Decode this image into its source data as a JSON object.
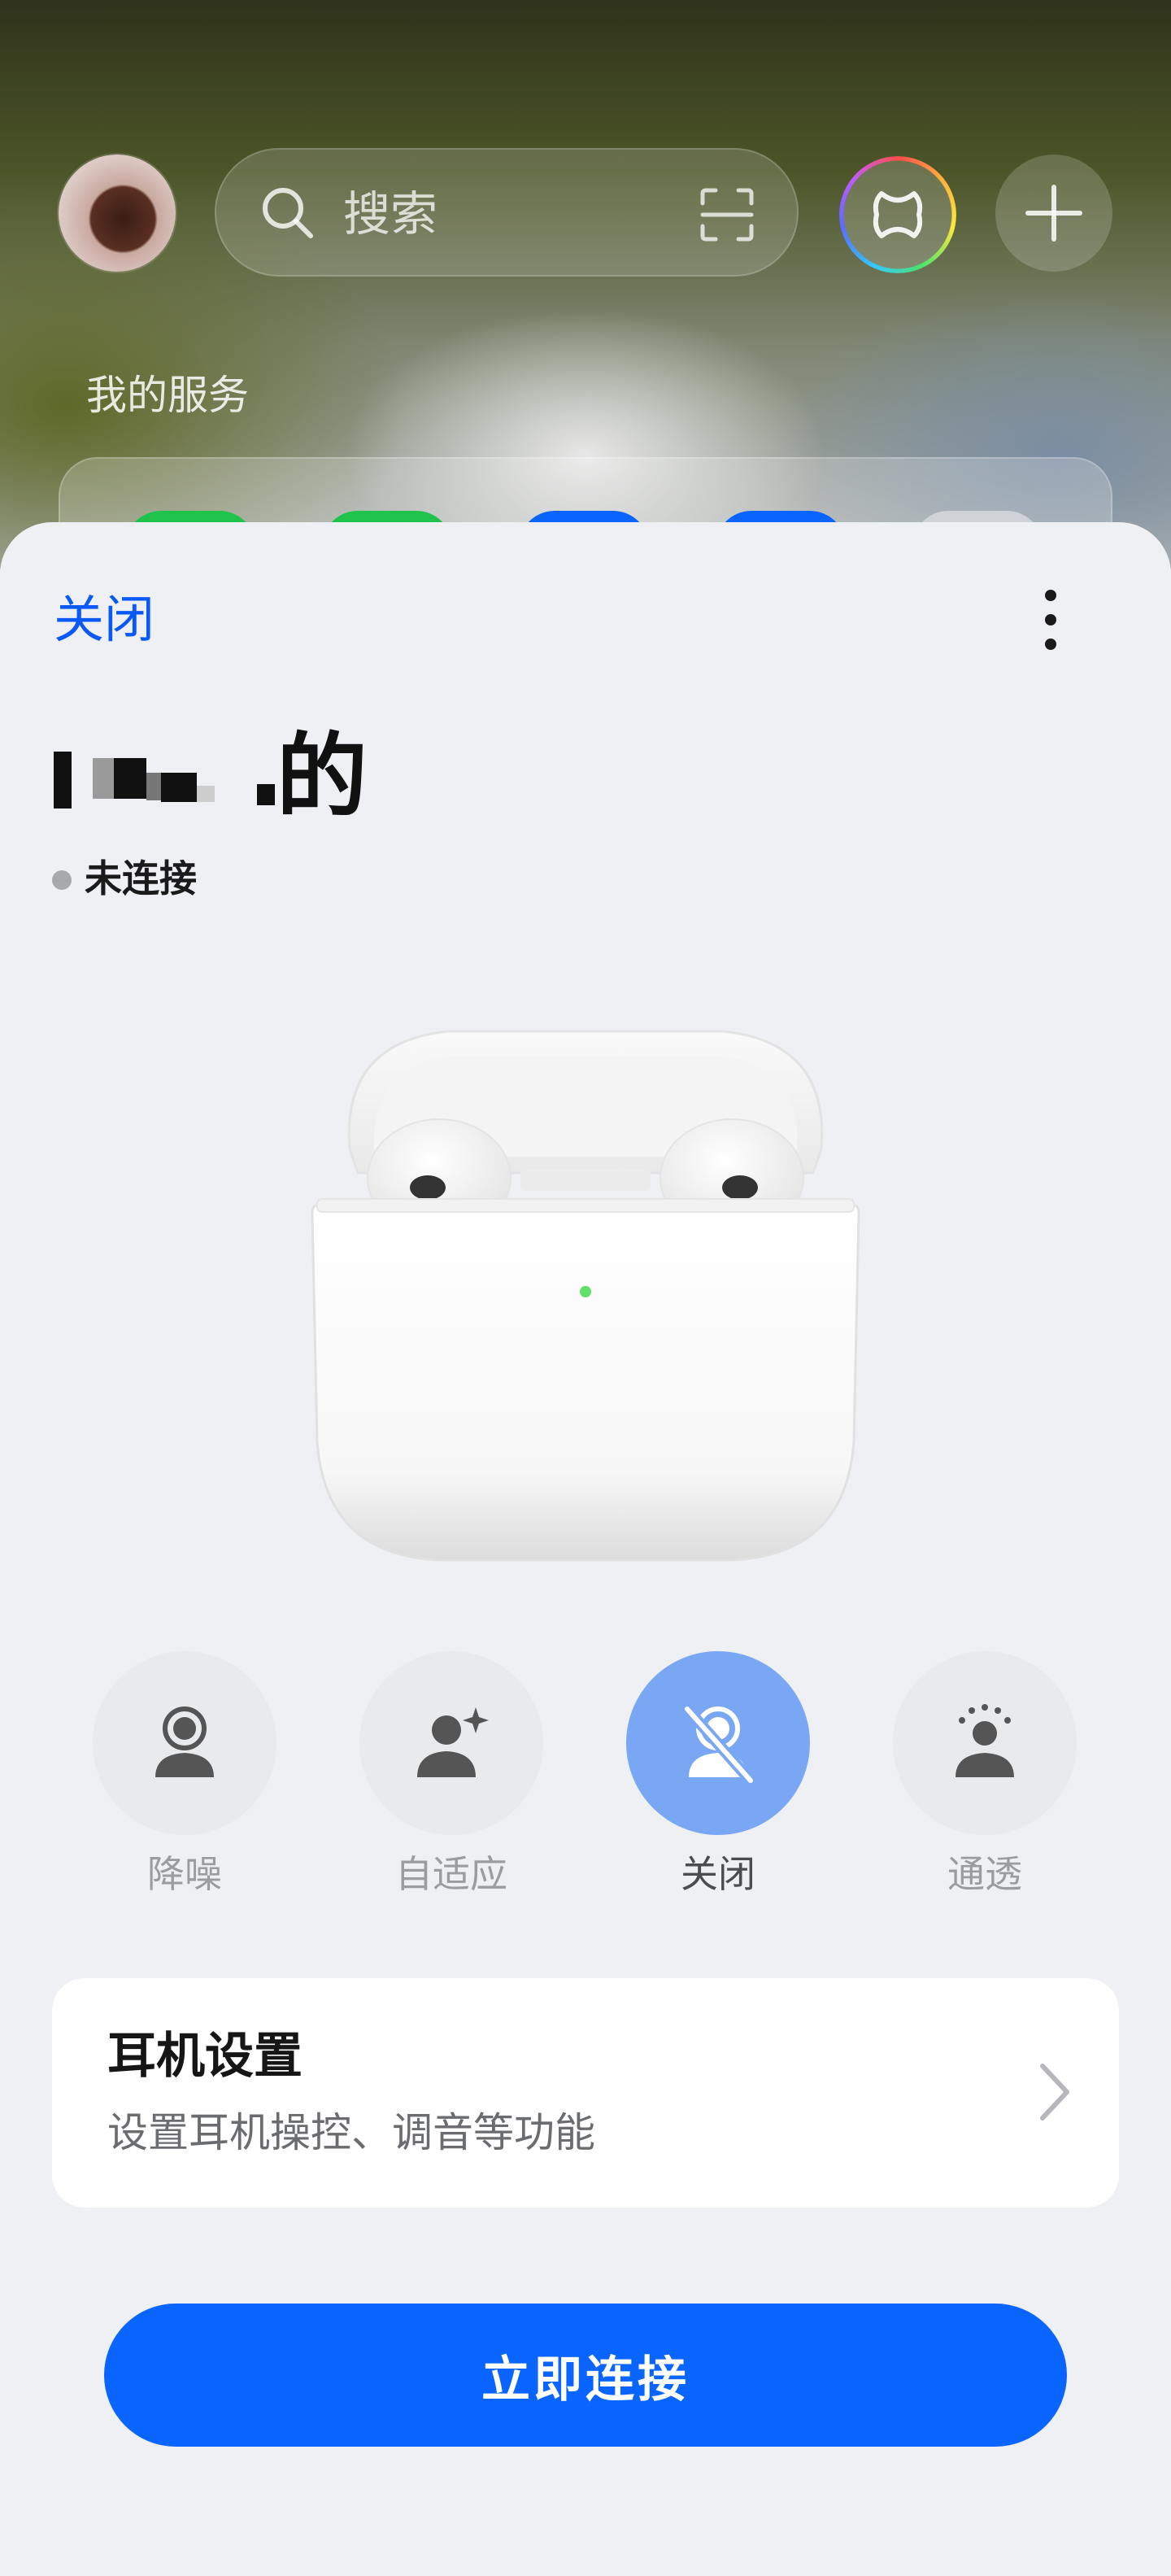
{
  "top_bar": {
    "search_placeholder": "搜索"
  },
  "services": {
    "section_title": "我的服务",
    "app_colors": [
      "#1fc24a",
      "#1fc24a",
      "#0a64ff",
      "#0a64ff",
      "#cfd2d6"
    ]
  },
  "sheet": {
    "close_label": "关闭",
    "device_name": "的",
    "status": "未连接",
    "modes": [
      {
        "label": "降噪",
        "icon": "noise-cancel-icon",
        "active": false
      },
      {
        "label": "自适应",
        "icon": "adaptive-icon",
        "active": false
      },
      {
        "label": "关闭",
        "icon": "anc-off-icon",
        "active": true
      },
      {
        "label": "通透",
        "icon": "transparency-icon",
        "active": false
      }
    ],
    "settings": {
      "title": "耳机设置",
      "subtitle": "设置耳机操控、调音等功能"
    },
    "connect_button": "立即连接"
  },
  "colors": {
    "accent": "#0a64ff",
    "link": "#0a59f7",
    "active_mode": "#7aa7f4",
    "status_dot": "#a7a9ad"
  }
}
